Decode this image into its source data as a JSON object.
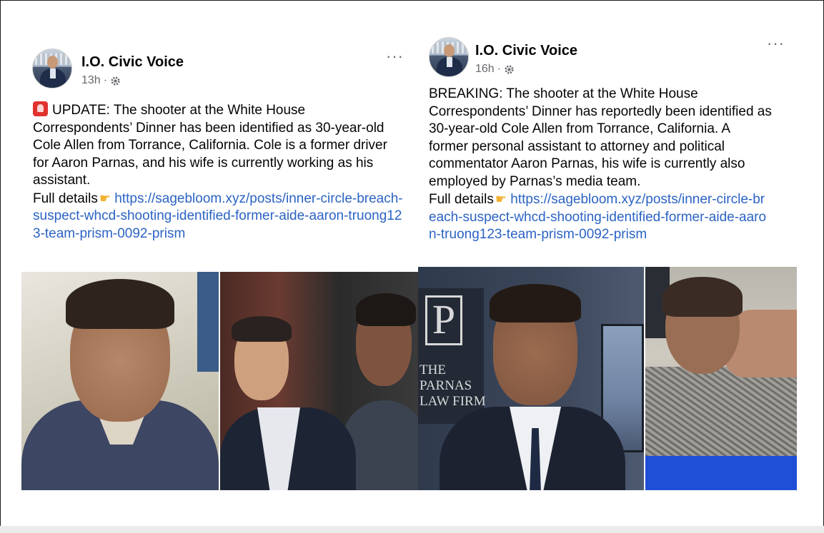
{
  "posts": [
    {
      "page_name": "I.O. Civic Voice",
      "time": "13h",
      "dot": "·",
      "more": "···",
      "text_prefix": "UPDATE: The shooter at the White House Correspondents’ Dinner has been identified as 30-year-old Cole Allen from Torrance, California. Cole is a former driver for Aaron Parnas, and his wife is currently working as his assistant.",
      "details_label": "Full details",
      "link": "https://sagebloom.xyz/posts/inner-circle-breach-suspect-whcd-shooting-identified-former-aide-aaron-truong123-team-prism-0092-prism",
      "icons": [
        "alert-siren-icon",
        "pointing-hand-icon",
        "globe-gear-icon",
        "more-options-icon"
      ]
    },
    {
      "page_name": "I.O. Civic Voice",
      "time": "16h",
      "dot": "·",
      "more": "···",
      "text_prefix": "BREAKING: The shooter at the White House Correspondents’ Dinner has reportedly been identified as 30-year-old Cole Allen from Torrance, California. A former personal assistant to attorney and political commentator Aaron Parnas, his wife is currently also employed by Parnas’s media team.",
      "details_label": "Full details",
      "link": "https://sagebloom.xyz/posts/inner-circle-breach-suspect-whcd-shooting-identified-former-aide-aaron-truong123-team-prism-0092-prism",
      "sign_letter": "P",
      "sign_text": "THE PARNAS LAW FIRM",
      "icons": [
        "pointing-hand-icon",
        "globe-gear-icon",
        "more-options-icon"
      ]
    }
  ],
  "colors": {
    "link": "#2b63c4",
    "meta": "#65676b",
    "text": "#050505"
  }
}
